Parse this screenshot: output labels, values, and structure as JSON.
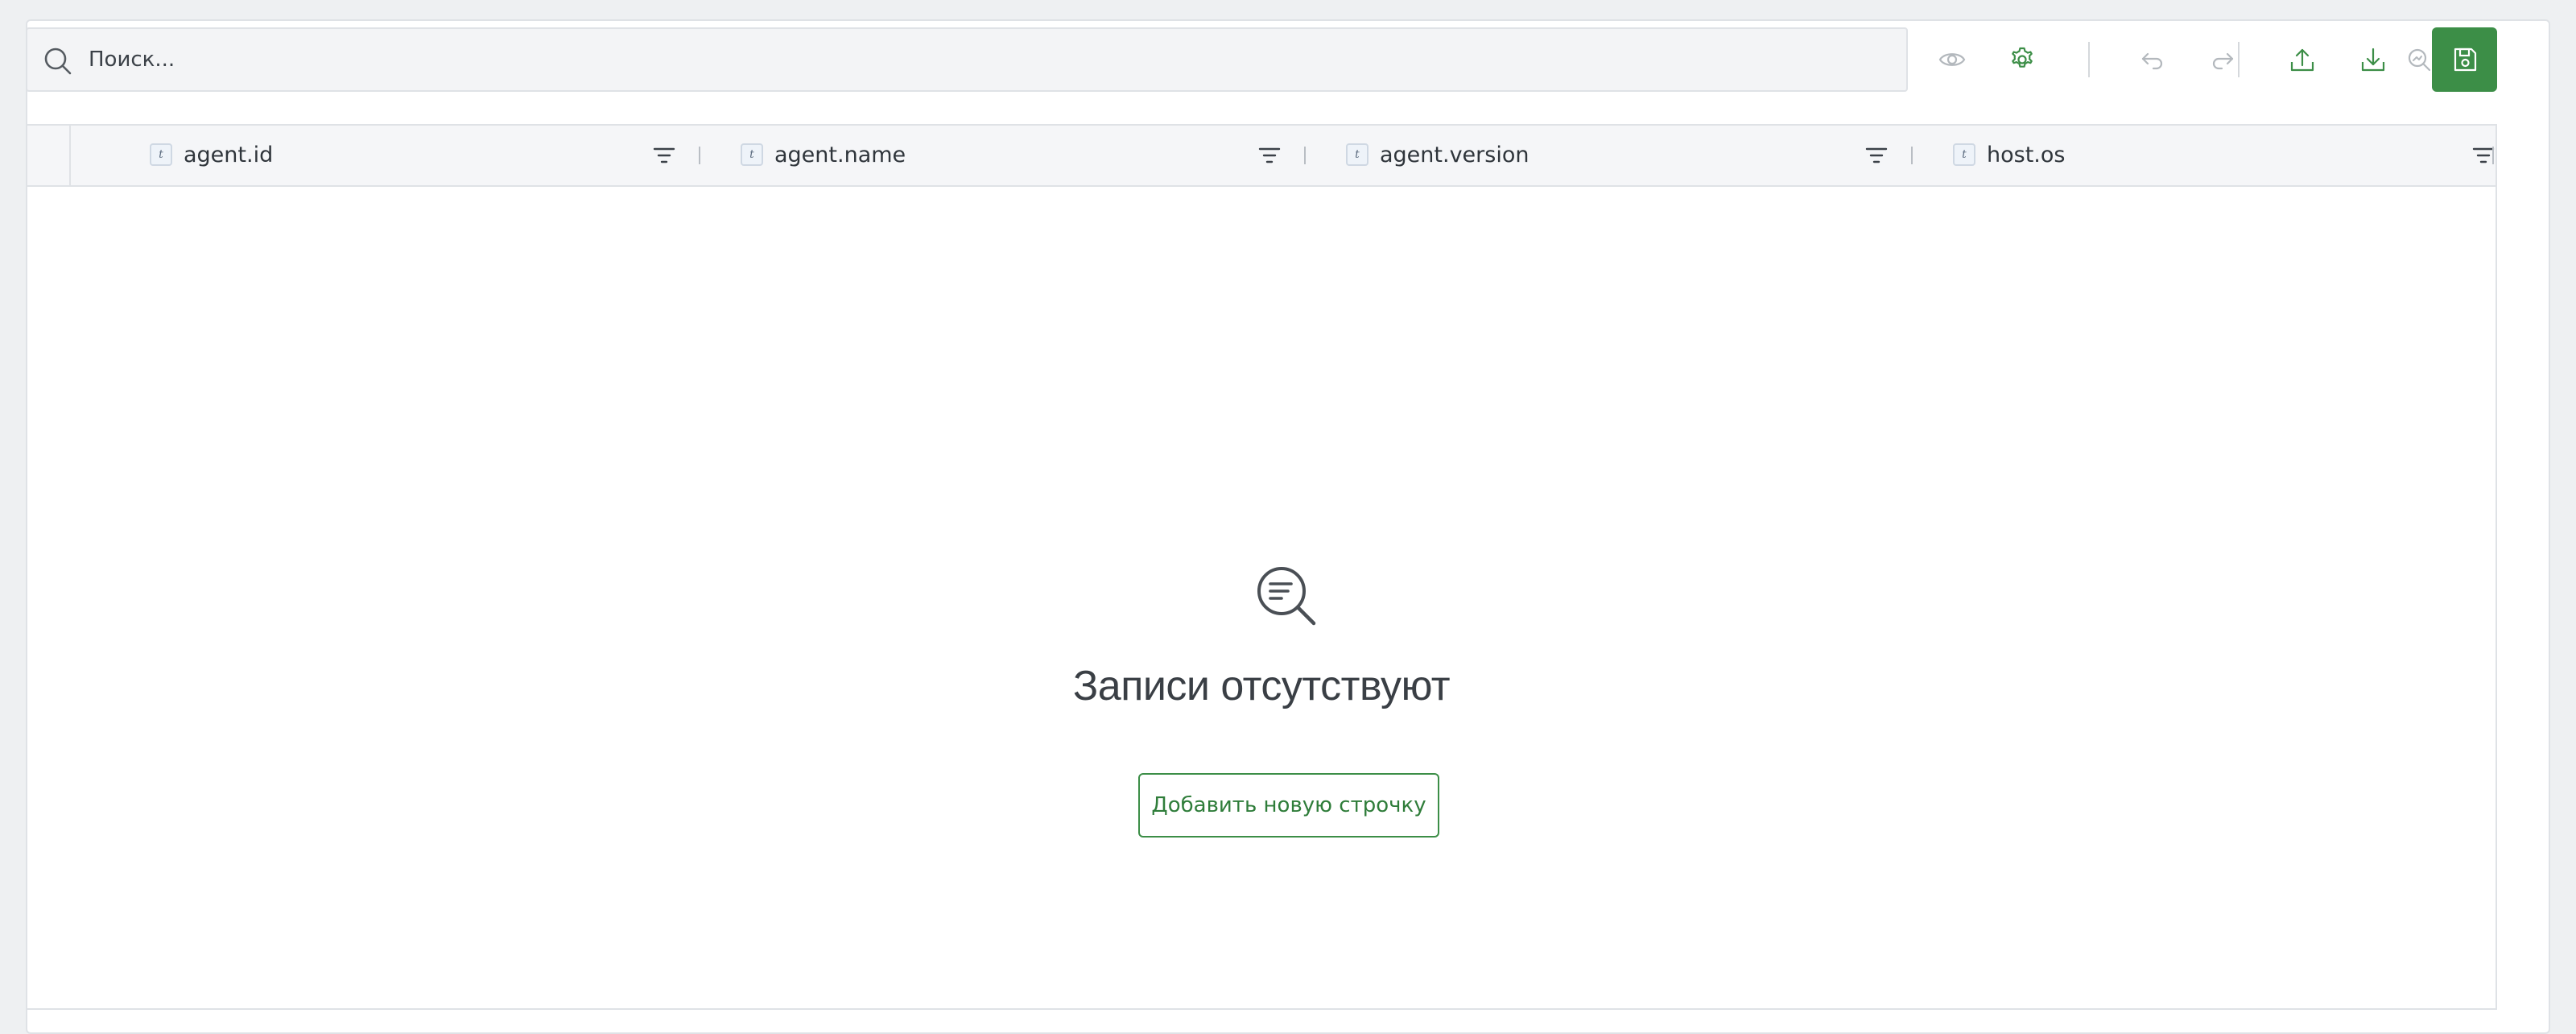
{
  "search": {
    "placeholder": "Поиск..."
  },
  "toolbar": {
    "icons": [
      "eye-icon",
      "gear-icon",
      "undo-icon",
      "redo-icon",
      "upload-icon",
      "download-icon",
      "search-reset-icon",
      "save-icon"
    ],
    "accent_color": "#3c8e47"
  },
  "table": {
    "columns": [
      {
        "type": "t",
        "name": "agent.id"
      },
      {
        "type": "t",
        "name": "agent.name"
      },
      {
        "type": "t",
        "name": "agent.version"
      },
      {
        "type": "t",
        "name": "host.os"
      }
    ]
  },
  "empty_state": {
    "title": "Записи отсутствуют",
    "add_button_label": "Добавить новую строчку"
  }
}
